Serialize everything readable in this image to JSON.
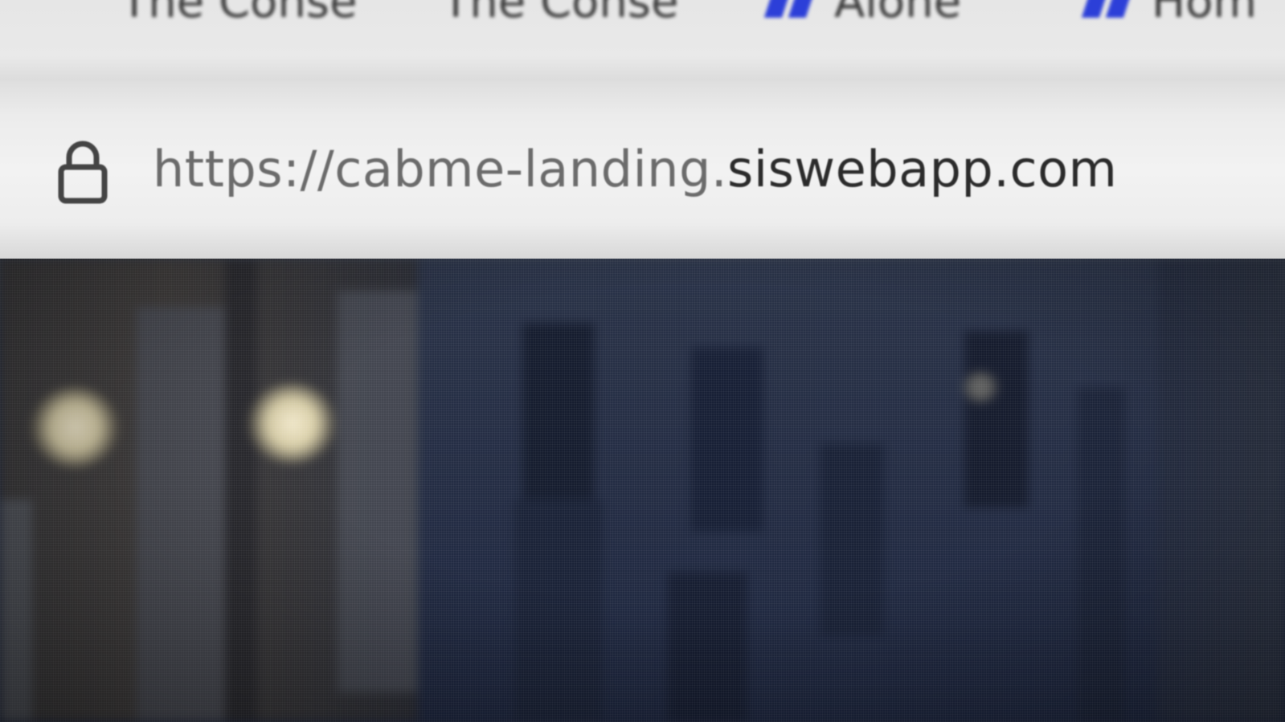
{
  "bookmarks": [
    {
      "label": "The Conse",
      "icon": "bookmark-page-icon"
    },
    {
      "label": "The Conse",
      "icon": "bookmark-page-icon"
    },
    {
      "label": "Alone",
      "icon": "site-favicon-icon"
    },
    {
      "label": "Hom",
      "icon": "site-favicon-icon"
    }
  ],
  "address_bar": {
    "security_icon": "lock-icon",
    "url_prefix": "https://cabme-landing.",
    "url_domain": "siswebapp.com"
  },
  "colors": {
    "favicon": "#2c3fd8",
    "url_text": "#4a4a4a",
    "page_background": "#1f2840"
  }
}
